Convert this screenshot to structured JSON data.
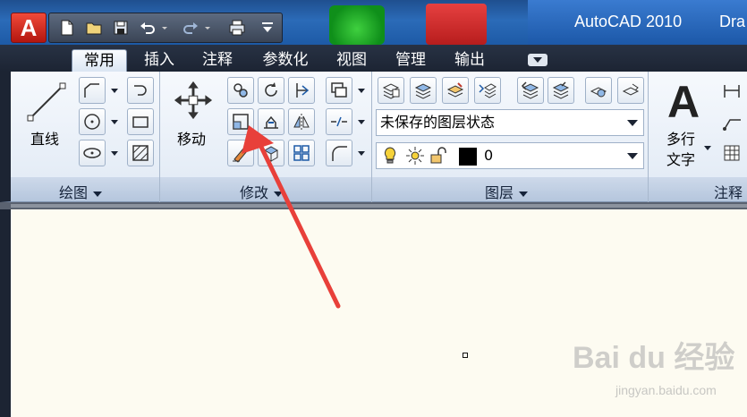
{
  "title_bar": {
    "app_title": "AutoCAD 2010",
    "doc_title_fragment": "Dra",
    "logo_letter": "A"
  },
  "tabs": [
    {
      "label": "常用",
      "active": true
    },
    {
      "label": "插入"
    },
    {
      "label": "注释"
    },
    {
      "label": "参数化"
    },
    {
      "label": "视图"
    },
    {
      "label": "管理"
    },
    {
      "label": "输出"
    }
  ],
  "draw_panel": {
    "title": "绘图",
    "line_label": "直线"
  },
  "modify_panel": {
    "title": "修改",
    "move_label": "移动"
  },
  "layers_panel": {
    "title": "图层",
    "layer_state": "未保存的图层状态",
    "current_layer": "0"
  },
  "annotation_panel": {
    "title": "注释",
    "mtext_label_line1": "多行",
    "mtext_label_line2": "文字",
    "mtext_icon_letter": "A"
  },
  "watermark": {
    "brand": "Bai du 经验",
    "url": "jingyan.baidu.com"
  },
  "colors": {
    "annotation_arrow": "#e8403a",
    "ribbon_bg": "#e4ecf6",
    "canvas_bg": "#fdfbf1"
  }
}
